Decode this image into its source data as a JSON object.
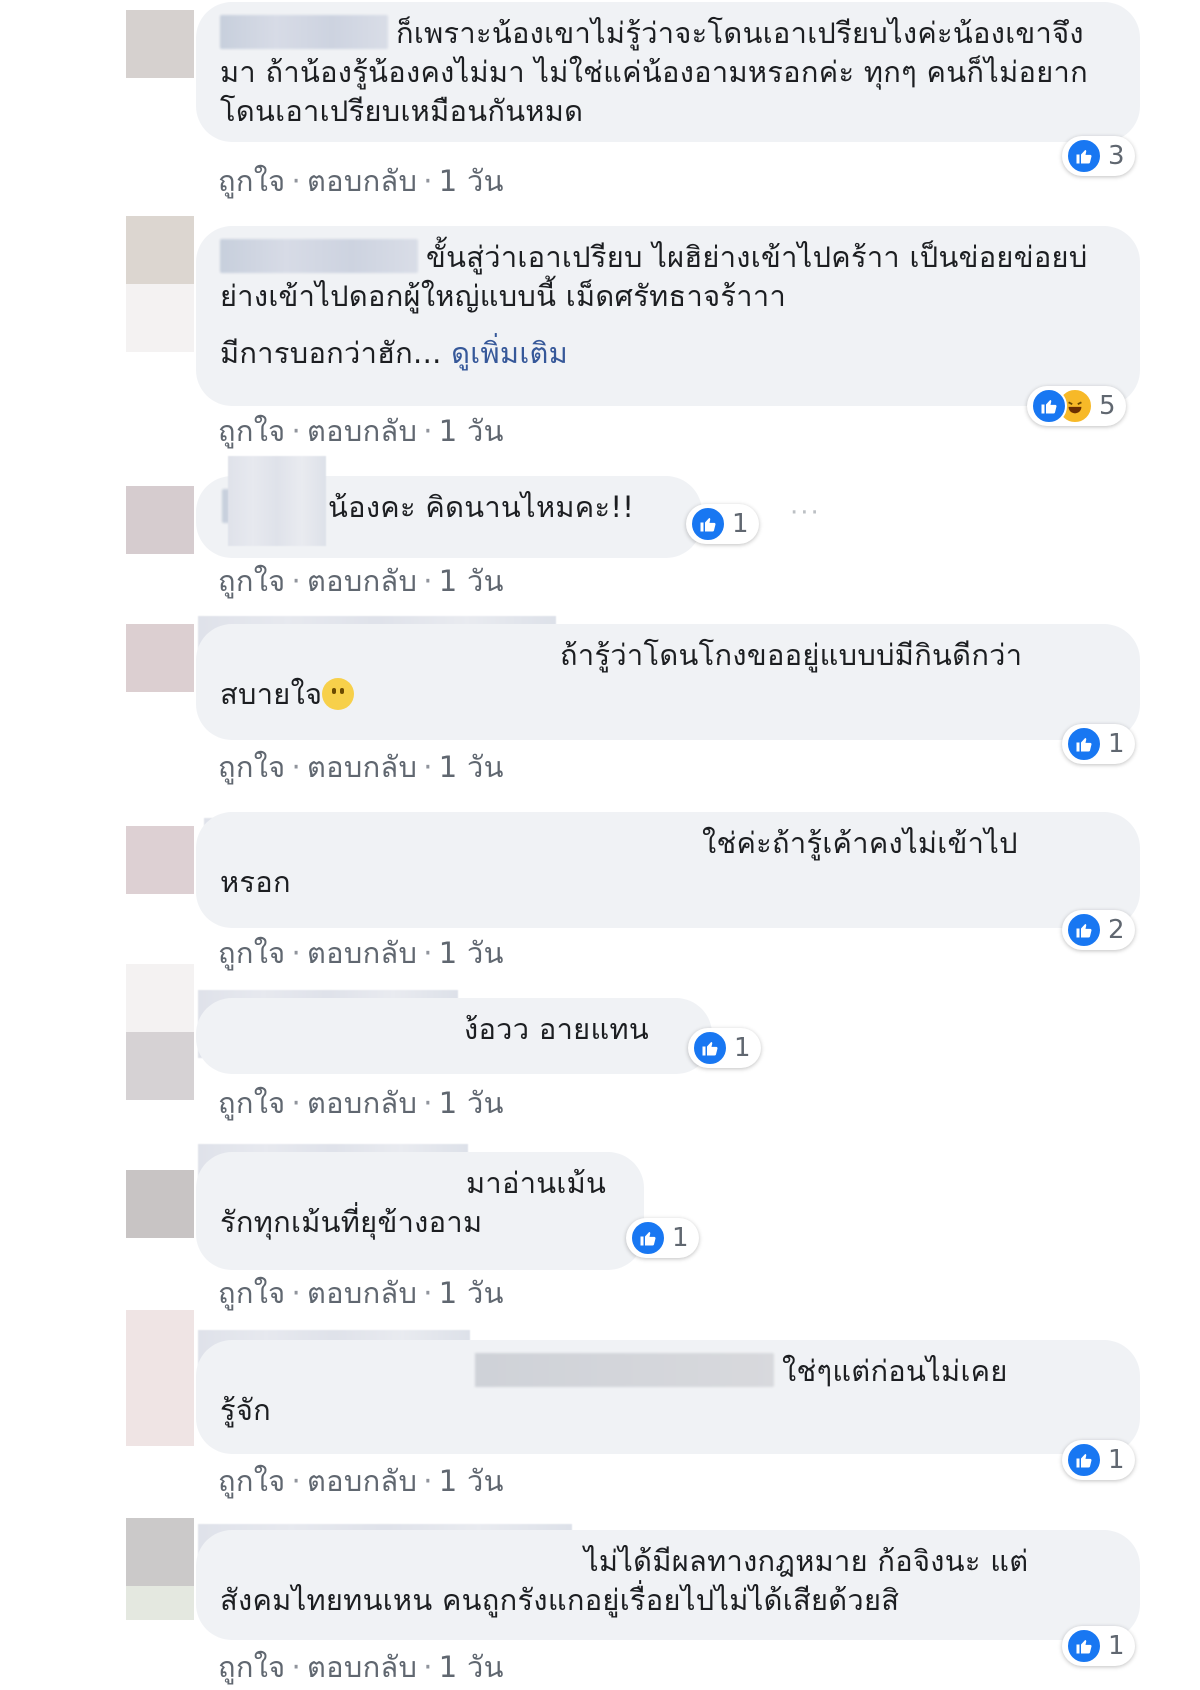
{
  "comments": [
    {
      "text": "ก็เพราะน้องเขาไม่รู้ว่าจะโดนเอาเปรียบไงค่ะน้องเขาจึงมา ถ้าน้องรู้น้องคงไม่มา ไม่ใช่แค่น้องอามหรอกค่ะ ทุกๆ คนก็ไม่อยากโดนเอาเปรียบเหมือนกันหมด",
      "reactions": "3",
      "like_label": "ถูกใจ",
      "reply_label": "ตอบกลับ",
      "time": "1 วัน"
    },
    {
      "text": "ขั้นสู่ว่าเอาเปรียบ ไผฮิย่างเข้าไปคร้าา เป็นข่อยข่อยบ่ย่างเข้าไปดอกผู้ใหญ่แบบนี้ เม็ดศรัทธาจร้าาา",
      "text2": "มีการบอกว่าฮัก...",
      "see_more": "ดูเพิ่มเติม",
      "reactions": "5",
      "like_label": "ถูกใจ",
      "reply_label": "ตอบกลับ",
      "time": "1 วัน"
    },
    {
      "text": "น้องคะ คิดนานไหมคะ!!",
      "reactions": "1",
      "more": "···",
      "like_label": "ถูกใจ",
      "reply_label": "ตอบกลับ",
      "time": "1 วัน"
    },
    {
      "text": "ถ้ารู้ว่าโดนโกงขออยู่แบบบ่มีกินดีกว่า",
      "text2": "สบายใจ",
      "reactions": "1",
      "like_label": "ถูกใจ",
      "reply_label": "ตอบกลับ",
      "time": "1 วัน"
    },
    {
      "text": "ใช่ค่ะถ้ารู้เค้าคงไม่เข้าไป",
      "text2": "หรอก",
      "reactions": "2",
      "like_label": "ถูกใจ",
      "reply_label": "ตอบกลับ",
      "time": "1 วัน"
    },
    {
      "text": "ง้อวว อายแทน",
      "reactions": "1",
      "like_label": "ถูกใจ",
      "reply_label": "ตอบกลับ",
      "time": "1 วัน"
    },
    {
      "text": "มาอ่านเม้น",
      "text2": "รักทุกเม้นที่ยุข้างอาม",
      "reactions": "1",
      "like_label": "ถูกใจ",
      "reply_label": "ตอบกลับ",
      "time": "1 วัน"
    },
    {
      "text": "ใช่ๆแต่ก่อนไม่เคย",
      "text2": "รู้จัก",
      "reactions": "1",
      "like_label": "ถูกใจ",
      "reply_label": "ตอบกลับ",
      "time": "1 วัน"
    },
    {
      "text": "ไม่ได้มีผลทางกฎหมาย ก้อจิงนะ แต่",
      "text2": "สังคมไทยทนเหน คนถูกรังแกอยู่เรื่อยไปไม่ได้เสียด้วยสิ",
      "reactions": "1",
      "like_label": "ถูกใจ",
      "reply_label": "ตอบกลับ",
      "time": "1 วัน"
    }
  ],
  "colors": {
    "like_blue": "#1877f2",
    "bubble_bg": "#f0f2f5",
    "meta_text": "#606770",
    "link": "#365899"
  }
}
